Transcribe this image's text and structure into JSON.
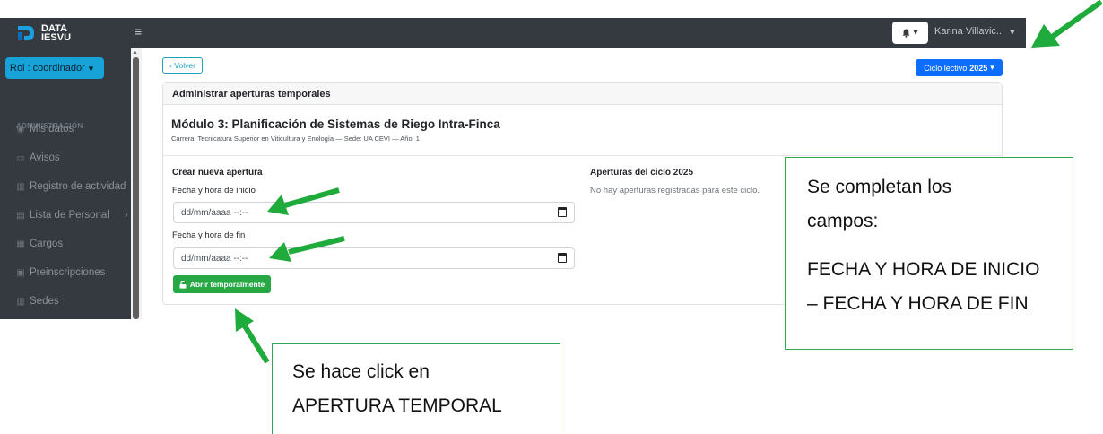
{
  "brand": {
    "line1": "DATA",
    "line2": "IESVU"
  },
  "topbar": {
    "menu_glyph": "≡",
    "bell_caret": "▾",
    "user_name": "Karina Villavic...",
    "user_caret": "▾"
  },
  "sidebar": {
    "role_button": "Rol : coordinador",
    "role_caret": "▾",
    "section_header": "ADMINISTRACIÓN",
    "items": [
      {
        "icon": "user-circle-icon",
        "label": "Mis datos"
      },
      {
        "icon": "comment-icon",
        "label": "Avisos"
      },
      {
        "icon": "chart-icon",
        "label": "Registro de actividad"
      },
      {
        "icon": "list-icon",
        "label": "Lista de Personal",
        "has_submenu": true
      },
      {
        "icon": "id-card-icon",
        "label": "Cargos"
      },
      {
        "icon": "form-icon",
        "label": "Preinscripciones"
      },
      {
        "icon": "building-icon",
        "label": "Sedes"
      }
    ]
  },
  "main": {
    "back_button": "‹ Volver",
    "ciclo_button": {
      "prefix": "Ciclo lectivo",
      "year": "2025",
      "caret": "▾"
    },
    "card": {
      "header": "Administrar aperturas temporales",
      "title": "Módulo 3: Planificación de Sistemas de Riego Intra-Finca",
      "subtitle": "Carrera: Tecnicatura Superior en Viticultura y Enología — Sede: UA CEVI — Año: 1",
      "form": {
        "section_title": "Crear nueva apertura",
        "start_label": "Fecha y hora de inicio",
        "start_value": "dd/mm/aaaa --:--",
        "end_label": "Fecha y hora de fin",
        "end_value": "dd/mm/aaaa --:--",
        "submit_label": "Abrir temporalmente"
      },
      "list": {
        "title": "Aperturas del ciclo 2025",
        "empty_text": "No hay aperturas registradas para este ciclo."
      }
    }
  },
  "annotations": {
    "right_box": {
      "line1": "Se completan los",
      "line2": "campos:",
      "line3": "FECHA Y HORA DE INICIO",
      "line4": "– FECHA Y HORA DE FIN"
    },
    "bottom_box": {
      "line1": "Se hace click en",
      "line2": "APERTURA TEMPORAL"
    }
  },
  "colors": {
    "navbar": "#343a40",
    "role_button": "#17a2d8",
    "ciclo_button": "#0d6efd",
    "submit_button": "#28a745",
    "annotation_arrow": "#1faa3c"
  }
}
